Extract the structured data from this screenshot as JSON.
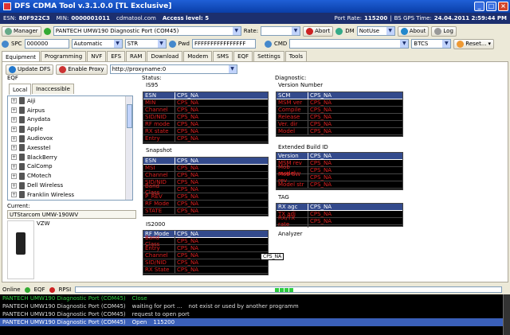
{
  "window": {
    "title": "DFS CDMA Tool v.3.1.0.0 [TL Exclusive]"
  },
  "info": {
    "esn_label": "ESN:",
    "esn": "80F922C3",
    "min_label": "MIN:",
    "min": "0000001011",
    "site": "cdmatool.com",
    "access": "Access level: 5",
    "port_rate_label": "Port Rate:",
    "port_rate": "115200",
    "gps_label": "BS GPS Time:",
    "gps_time": "24.04.2011 2:59:44 PM"
  },
  "toolbar1": {
    "manager": "Manager",
    "port": "PANTECH UMW190 Diagnostic Port (COM45)",
    "rate_label": "Rate:",
    "abort": "Abort",
    "dm": "DM",
    "dm_value": "NotUse",
    "about": "About",
    "log": "Log"
  },
  "toolbar2": {
    "spc_label": "SPC",
    "spc_value": "000000",
    "mode": "Automatic",
    "mode2": "STR",
    "pwd_label": "Pwd",
    "pwd_value": "FFFFFFFFFFFFFFFF",
    "cmd_label": "CMD",
    "cmd_value": "BTCS",
    "reset": "Reset..."
  },
  "tabs": [
    "Equipment",
    "Programming",
    "NVF",
    "EFS",
    "RAM",
    "Download",
    "Modem",
    "SMS",
    "EQF",
    "Settings",
    "Tools"
  ],
  "subtoolbar": {
    "update": "Update DFS",
    "proxy": "Enable Proxy",
    "proxy_url": "http://proxyname:0"
  },
  "eqf": {
    "group": "EQF",
    "tab_local": "Local",
    "tab_inacc": "Inaccessible",
    "items": [
      "Aiji",
      "Airpus",
      "Anydata",
      "Apple",
      "Audiovox",
      "Axesstel",
      "BlackBerry",
      "CalComp",
      "CMotech",
      "Dell Wireless",
      "Franklin Wireless"
    ]
  },
  "current": {
    "group": "Current:",
    "device": "UTStarcom UMW-190WV",
    "carrier": "VZW"
  },
  "status": {
    "group": "Status:",
    "is95": {
      "title": "IS95",
      "rows": [
        [
          "ESN",
          "CPS_NA"
        ],
        [
          "MIN",
          "CPS_NA"
        ],
        [
          "Channel",
          "CPS_NA"
        ],
        [
          "SID/NID",
          "CPS_NA"
        ],
        [
          "RF mode",
          "CPS_NA"
        ],
        [
          "RX state",
          "CPS_NA"
        ],
        [
          "Entry",
          "CPS_NA"
        ]
      ]
    },
    "snapshot": {
      "title": "Snapshot",
      "rows": [
        [
          "ESN",
          "CPS_NA"
        ],
        [
          "MSI",
          "CPS_NA"
        ],
        [
          "Channel",
          "CPS_NA"
        ],
        [
          "SID/NID",
          "CPS_NA"
        ],
        [
          "Band Class",
          "CPS_NA"
        ],
        [
          "P_REV",
          "CPS_NA"
        ],
        [
          "RF Mode",
          "CPS_NA"
        ],
        [
          "STATE",
          "CPS_NA"
        ]
      ]
    },
    "is2000": {
      "title": "IS2000",
      "rows": [
        [
          "RF Mode",
          "CPS_NA"
        ],
        [
          "Band Class",
          "CPS_NA"
        ],
        [
          "Entry",
          "CPS_NA"
        ],
        [
          "Channel",
          "CPS_NA"
        ],
        [
          "SID/NID",
          "CPS_NA"
        ],
        [
          "RX State",
          "CPS_NA"
        ]
      ]
    },
    "tooltip": "CPS_NA"
  },
  "diagnostic": {
    "group": "Diagnostic:",
    "version": {
      "title": "Version Number",
      "rows": [
        [
          "SCM",
          "CPS_NA"
        ],
        [
          "MSM ver",
          "CPS_NA"
        ],
        [
          "Compile",
          "CPS_NA"
        ],
        [
          "Release",
          "CPS_NA"
        ],
        [
          "Ver. dir",
          "CPS_NA"
        ],
        [
          "Model",
          "CPS_NA"
        ]
      ]
    },
    "ext": {
      "title": "Extended Build ID",
      "rows": [
        [
          "Version",
          "CPS_NA"
        ],
        [
          "MSM rev",
          "CPS_NA"
        ],
        [
          "Mob model",
          "CPS_NA"
        ],
        [
          "Mob SW rev",
          "CPS_NA"
        ],
        [
          "Model str",
          "CPS_NA"
        ]
      ]
    },
    "tag": {
      "title": "TAG",
      "rows": [
        [
          "RX agc",
          "CPS_NA"
        ],
        [
          "TX adj",
          "CPS_NA"
        ],
        [
          "RX/TX rate",
          "CPS_NA"
        ]
      ]
    },
    "analyzer": "Analyzer"
  },
  "statusbar": {
    "online": "Online",
    "eqf": "EQF",
    "rpsi": "RPSI"
  },
  "log": [
    {
      "port": "PANTECH UMW190 Diagnostic Port (COM45)",
      "msg": "Close",
      "val": "",
      "color": "#2ecc40"
    },
    {
      "port": "PANTECH UMW190 Diagnostic Port (COM45)",
      "msg": "waiting for port ...",
      "val": "not exist or used by another programm",
      "color": "#dddddd"
    },
    {
      "port": "PANTECH UMW190 Diagnostic Port (COM45)",
      "msg": "request to open port",
      "val": "",
      "color": "#dddddd"
    },
    {
      "port": "PANTECH UMW190 Diagnostic Port (COM45)",
      "msg": "Open",
      "val": "115200",
      "color": "#ffffff"
    }
  ]
}
